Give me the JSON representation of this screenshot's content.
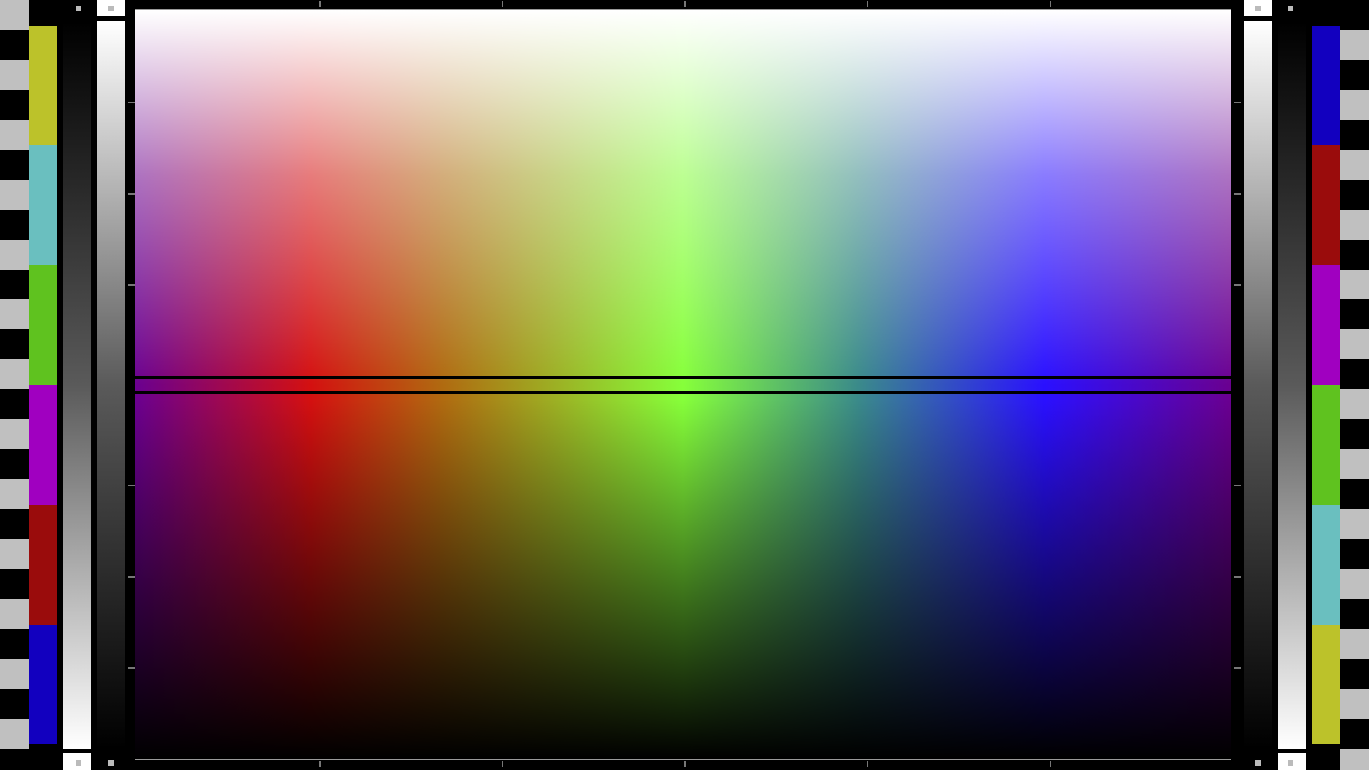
{
  "pattern": {
    "colors": {
      "yellow": "#bcc22a",
      "cyan": "#6abfbf",
      "green": "#5fc21f",
      "magenta": "#a000c0",
      "red": "#9a0c0c",
      "blue": "#1200bf",
      "light_gray": "#c0c0c0",
      "black": "#000000",
      "white": "#ffffff"
    },
    "left_bar_order": [
      "yellow",
      "cyan",
      "green",
      "magenta",
      "red",
      "blue"
    ],
    "right_bar_order": [
      "blue",
      "red",
      "magenta",
      "green",
      "cyan",
      "yellow"
    ],
    "main_gradient_hues": [
      "purple",
      "red",
      "yellow-brown",
      "green",
      "teal",
      "blue",
      "purple"
    ]
  }
}
